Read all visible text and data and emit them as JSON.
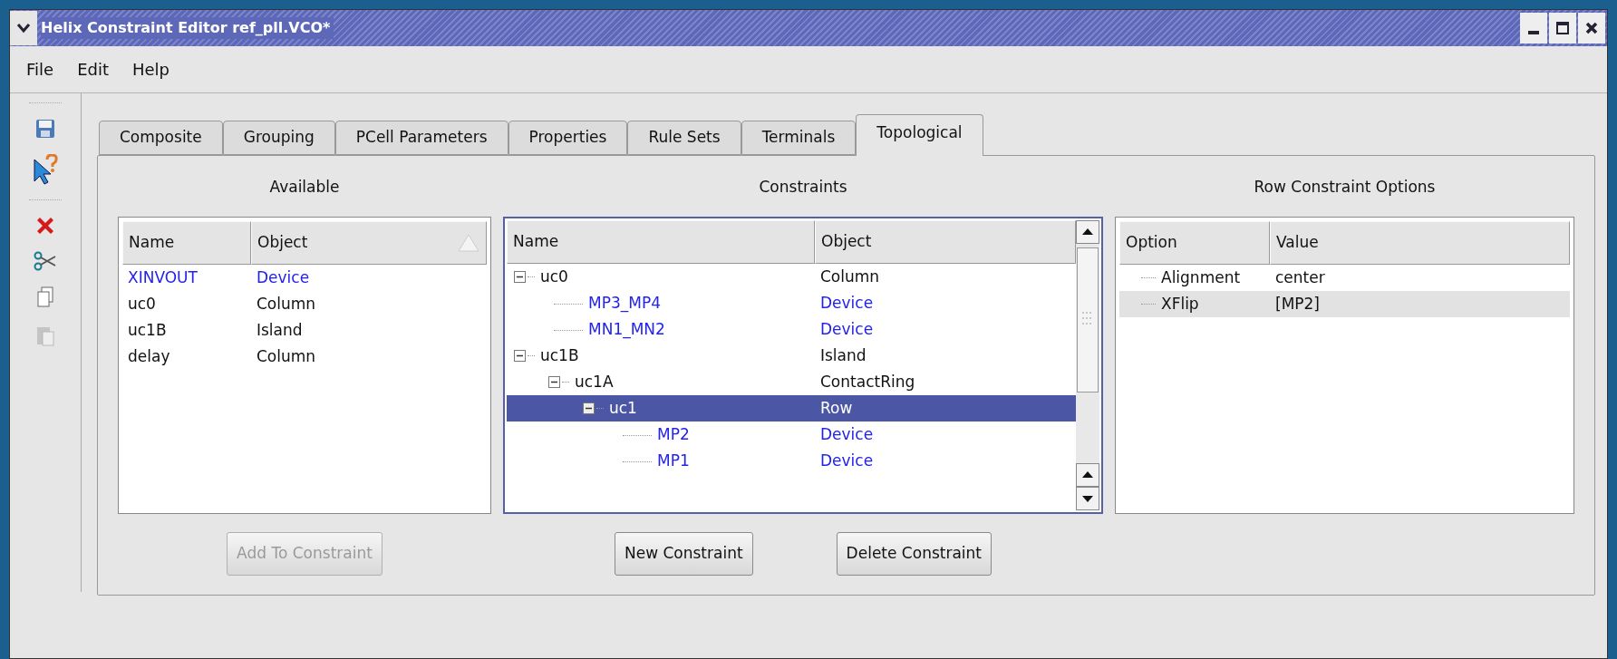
{
  "window": {
    "title": "Helix Constraint Editor ref_pll.VCO*"
  },
  "menu": [
    "File",
    "Edit",
    "Help"
  ],
  "toolbar": [
    {
      "kind": "save",
      "disabled": false
    },
    {
      "kind": "help",
      "disabled": false
    },
    {
      "kind": "delete",
      "disabled": false
    },
    {
      "kind": "cut",
      "disabled": false
    },
    {
      "kind": "copy",
      "disabled": false
    },
    {
      "kind": "paste",
      "disabled": true
    }
  ],
  "tabs": [
    {
      "label": "Composite",
      "selected": false
    },
    {
      "label": "Grouping",
      "selected": false
    },
    {
      "label": "PCell Parameters",
      "selected": false
    },
    {
      "label": "Properties",
      "selected": false
    },
    {
      "label": "Rule Sets",
      "selected": false
    },
    {
      "label": "Terminals",
      "selected": false
    },
    {
      "label": "Topological",
      "selected": true
    }
  ],
  "available": {
    "title": "Available",
    "columns": [
      "Name",
      "Object"
    ],
    "rows": [
      {
        "name": "XINVOUT",
        "object": "Device",
        "kind": "device"
      },
      {
        "name": "uc0",
        "object": "Column",
        "kind": "group"
      },
      {
        "name": "uc1B",
        "object": "Island",
        "kind": "group"
      },
      {
        "name": "delay",
        "object": "Column",
        "kind": "group"
      }
    ],
    "button": {
      "label": "Add To Constraint",
      "disabled": true
    }
  },
  "constraints": {
    "title": "Constraints",
    "columns": [
      "Name",
      "Object"
    ],
    "tree": [
      {
        "name": "uc0",
        "object": "Column",
        "kind": "group",
        "selected": false,
        "expanded": true,
        "children": [
          {
            "name": "MP3_MP4",
            "object": "Device",
            "kind": "device",
            "selected": false
          },
          {
            "name": "MN1_MN2",
            "object": "Device",
            "kind": "device",
            "selected": false
          }
        ]
      },
      {
        "name": "uc1B",
        "object": "Island",
        "kind": "group",
        "selected": false,
        "expanded": true,
        "children": [
          {
            "name": "uc1A",
            "object": "ContactRing",
            "kind": "group",
            "selected": false,
            "expanded": true,
            "children": [
              {
                "name": "uc1",
                "object": "Row",
                "kind": "group",
                "selected": true,
                "expanded": true,
                "children": [
                  {
                    "name": "MP2",
                    "object": "Device",
                    "kind": "device",
                    "selected": false
                  },
                  {
                    "name": "MP1",
                    "object": "Device",
                    "kind": "device",
                    "selected": false
                  }
                ]
              }
            ]
          }
        ]
      }
    ],
    "buttons": [
      "New Constraint",
      "Delete Constraint"
    ]
  },
  "options": {
    "title": "Row Constraint Options",
    "columns": [
      "Option",
      "Value"
    ],
    "rows": [
      {
        "option": "Alignment",
        "value": "center",
        "selected": false
      },
      {
        "option": "XFlip",
        "value": "[MP2]",
        "selected": true
      }
    ]
  }
}
